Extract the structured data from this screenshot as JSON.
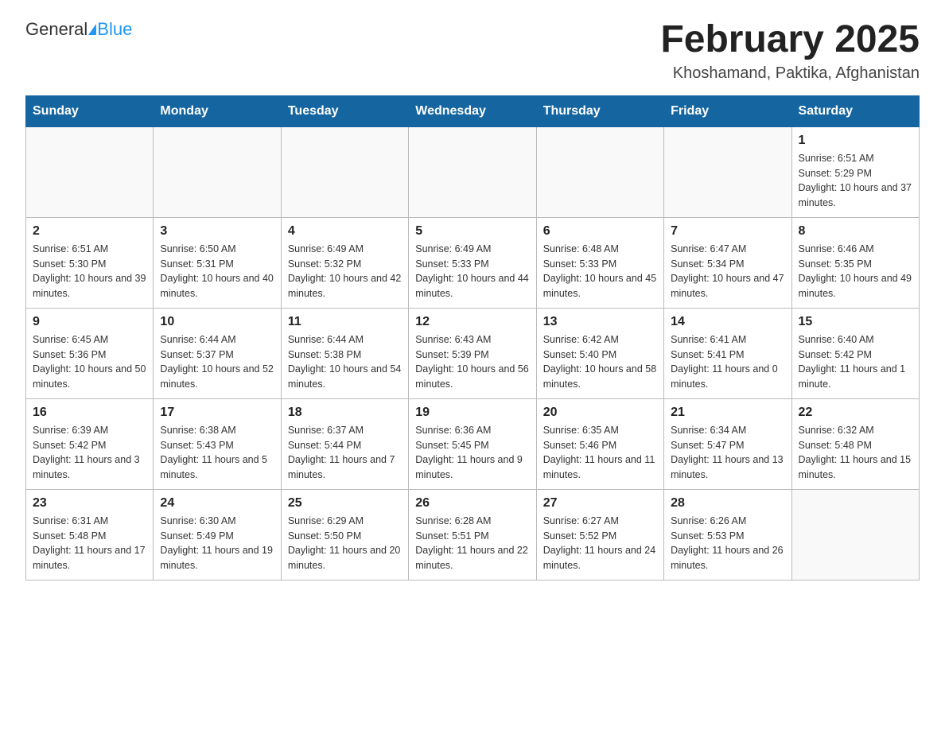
{
  "header": {
    "logo_general": "General",
    "logo_blue": "Blue",
    "month_title": "February 2025",
    "location": "Khoshamand, Paktika, Afghanistan"
  },
  "days_of_week": [
    "Sunday",
    "Monday",
    "Tuesday",
    "Wednesday",
    "Thursday",
    "Friday",
    "Saturday"
  ],
  "weeks": [
    [
      {
        "day": "",
        "info": ""
      },
      {
        "day": "",
        "info": ""
      },
      {
        "day": "",
        "info": ""
      },
      {
        "day": "",
        "info": ""
      },
      {
        "day": "",
        "info": ""
      },
      {
        "day": "",
        "info": ""
      },
      {
        "day": "1",
        "info": "Sunrise: 6:51 AM\nSunset: 5:29 PM\nDaylight: 10 hours and 37 minutes."
      }
    ],
    [
      {
        "day": "2",
        "info": "Sunrise: 6:51 AM\nSunset: 5:30 PM\nDaylight: 10 hours and 39 minutes."
      },
      {
        "day": "3",
        "info": "Sunrise: 6:50 AM\nSunset: 5:31 PM\nDaylight: 10 hours and 40 minutes."
      },
      {
        "day": "4",
        "info": "Sunrise: 6:49 AM\nSunset: 5:32 PM\nDaylight: 10 hours and 42 minutes."
      },
      {
        "day": "5",
        "info": "Sunrise: 6:49 AM\nSunset: 5:33 PM\nDaylight: 10 hours and 44 minutes."
      },
      {
        "day": "6",
        "info": "Sunrise: 6:48 AM\nSunset: 5:33 PM\nDaylight: 10 hours and 45 minutes."
      },
      {
        "day": "7",
        "info": "Sunrise: 6:47 AM\nSunset: 5:34 PM\nDaylight: 10 hours and 47 minutes."
      },
      {
        "day": "8",
        "info": "Sunrise: 6:46 AM\nSunset: 5:35 PM\nDaylight: 10 hours and 49 minutes."
      }
    ],
    [
      {
        "day": "9",
        "info": "Sunrise: 6:45 AM\nSunset: 5:36 PM\nDaylight: 10 hours and 50 minutes."
      },
      {
        "day": "10",
        "info": "Sunrise: 6:44 AM\nSunset: 5:37 PM\nDaylight: 10 hours and 52 minutes."
      },
      {
        "day": "11",
        "info": "Sunrise: 6:44 AM\nSunset: 5:38 PM\nDaylight: 10 hours and 54 minutes."
      },
      {
        "day": "12",
        "info": "Sunrise: 6:43 AM\nSunset: 5:39 PM\nDaylight: 10 hours and 56 minutes."
      },
      {
        "day": "13",
        "info": "Sunrise: 6:42 AM\nSunset: 5:40 PM\nDaylight: 10 hours and 58 minutes."
      },
      {
        "day": "14",
        "info": "Sunrise: 6:41 AM\nSunset: 5:41 PM\nDaylight: 11 hours and 0 minutes."
      },
      {
        "day": "15",
        "info": "Sunrise: 6:40 AM\nSunset: 5:42 PM\nDaylight: 11 hours and 1 minute."
      }
    ],
    [
      {
        "day": "16",
        "info": "Sunrise: 6:39 AM\nSunset: 5:42 PM\nDaylight: 11 hours and 3 minutes."
      },
      {
        "day": "17",
        "info": "Sunrise: 6:38 AM\nSunset: 5:43 PM\nDaylight: 11 hours and 5 minutes."
      },
      {
        "day": "18",
        "info": "Sunrise: 6:37 AM\nSunset: 5:44 PM\nDaylight: 11 hours and 7 minutes."
      },
      {
        "day": "19",
        "info": "Sunrise: 6:36 AM\nSunset: 5:45 PM\nDaylight: 11 hours and 9 minutes."
      },
      {
        "day": "20",
        "info": "Sunrise: 6:35 AM\nSunset: 5:46 PM\nDaylight: 11 hours and 11 minutes."
      },
      {
        "day": "21",
        "info": "Sunrise: 6:34 AM\nSunset: 5:47 PM\nDaylight: 11 hours and 13 minutes."
      },
      {
        "day": "22",
        "info": "Sunrise: 6:32 AM\nSunset: 5:48 PM\nDaylight: 11 hours and 15 minutes."
      }
    ],
    [
      {
        "day": "23",
        "info": "Sunrise: 6:31 AM\nSunset: 5:48 PM\nDaylight: 11 hours and 17 minutes."
      },
      {
        "day": "24",
        "info": "Sunrise: 6:30 AM\nSunset: 5:49 PM\nDaylight: 11 hours and 19 minutes."
      },
      {
        "day": "25",
        "info": "Sunrise: 6:29 AM\nSunset: 5:50 PM\nDaylight: 11 hours and 20 minutes."
      },
      {
        "day": "26",
        "info": "Sunrise: 6:28 AM\nSunset: 5:51 PM\nDaylight: 11 hours and 22 minutes."
      },
      {
        "day": "27",
        "info": "Sunrise: 6:27 AM\nSunset: 5:52 PM\nDaylight: 11 hours and 24 minutes."
      },
      {
        "day": "28",
        "info": "Sunrise: 6:26 AM\nSunset: 5:53 PM\nDaylight: 11 hours and 26 minutes."
      },
      {
        "day": "",
        "info": ""
      }
    ]
  ]
}
